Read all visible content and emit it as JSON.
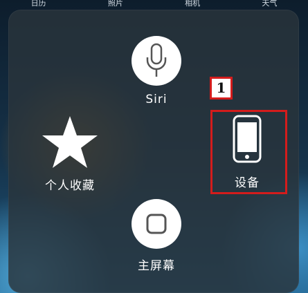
{
  "wallpaper": {
    "top_labels": [
      "日历",
      "照片",
      "相机",
      "天气"
    ]
  },
  "assistive_menu": {
    "items": [
      {
        "id": "siri",
        "label": "Siri",
        "icon": "microphone-icon"
      },
      {
        "id": "favorites",
        "label": "个人收藏",
        "icon": "star-icon"
      },
      {
        "id": "device",
        "label": "设备",
        "icon": "iphone-icon"
      },
      {
        "id": "home",
        "label": "主屏幕",
        "icon": "home-button-icon"
      }
    ]
  },
  "annotation": {
    "step_number": "1",
    "highlight_color": "#d41c1c"
  }
}
